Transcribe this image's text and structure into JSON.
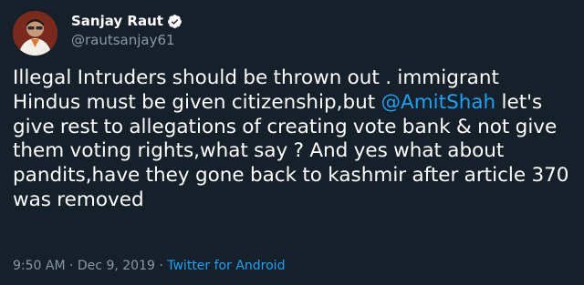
{
  "user": {
    "display_name": "Sanjay Raut",
    "handle": "@rautsanjay61"
  },
  "tweet": {
    "text_before_mention": "Illegal Intruders should be thrown out . immigrant Hindus must be given citizenship,but ",
    "mention": "@AmitShah",
    "text_after_mention": " let's give rest to allegations of creating vote bank & not give them voting rights,what say ? And yes what about pandits,have they gone back to kashmir after article 370 was removed"
  },
  "meta": {
    "time": "9:50 AM",
    "separator": " · ",
    "date": "Dec 9, 2019",
    "separator2": " · ",
    "source": "Twitter for Android"
  },
  "icons": {
    "verified": "verified-badge-icon"
  },
  "colors": {
    "background": "#15202b",
    "accent": "#1da1f2",
    "secondary_text": "#8899a6",
    "primary_text": "#ffffff"
  }
}
